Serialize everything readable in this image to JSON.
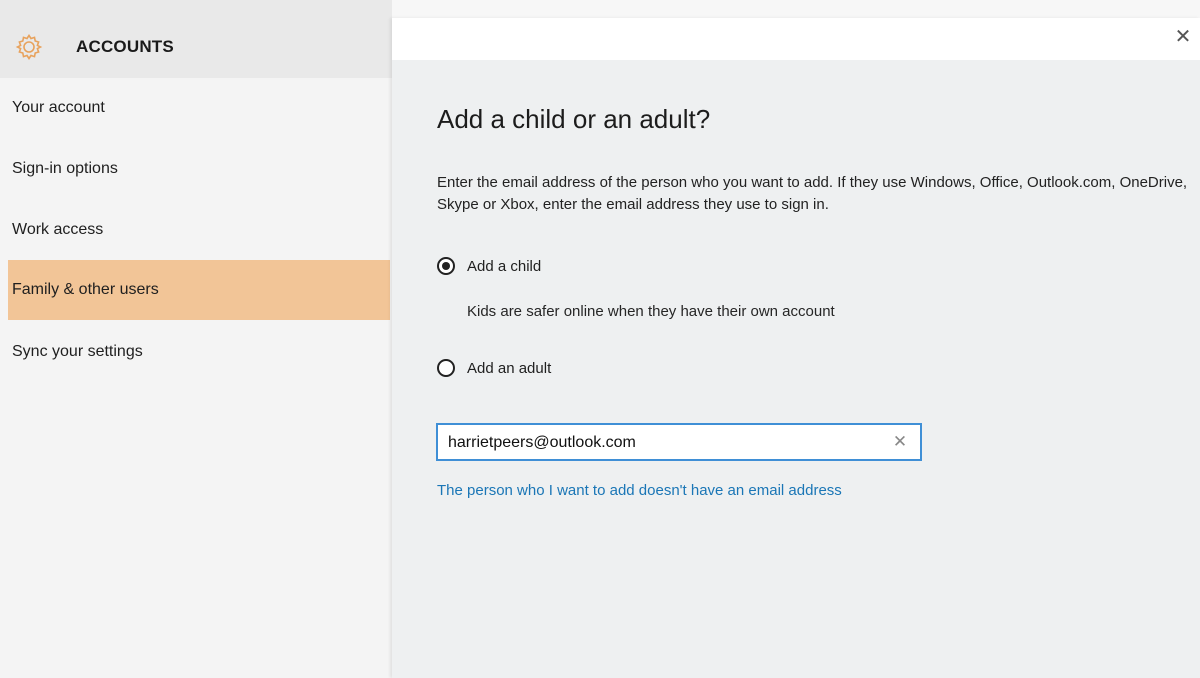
{
  "sidebar": {
    "title": "ACCOUNTS",
    "items": [
      {
        "label": "Your account",
        "selected": false
      },
      {
        "label": "Sign-in options",
        "selected": false
      },
      {
        "label": "Work access",
        "selected": false
      },
      {
        "label": "Family & other users",
        "selected": true
      },
      {
        "label": "Sync your settings",
        "selected": false
      }
    ],
    "accent_color": "#f2c597",
    "icon": "gear-icon"
  },
  "dialog": {
    "title": "Add a child or an adult?",
    "instructions": "Enter the email address of the person who you want to add. If they use Windows, Office, Outlook.com, OneDrive, Skype or Xbox, enter the email address they use to sign in.",
    "options": [
      {
        "label": "Add a child",
        "checked": true,
        "description": "Kids are safer online when they have their own account"
      },
      {
        "label": "Add an adult",
        "checked": false
      }
    ],
    "email_value": "harrietpeers@outlook.com",
    "link_text": "The person who I want to add doesn't have an email address",
    "link_color": "#1a76b6",
    "input_border_color": "#3f8fd6",
    "close_icon": "close-icon",
    "clear_icon": "clear-icon"
  }
}
